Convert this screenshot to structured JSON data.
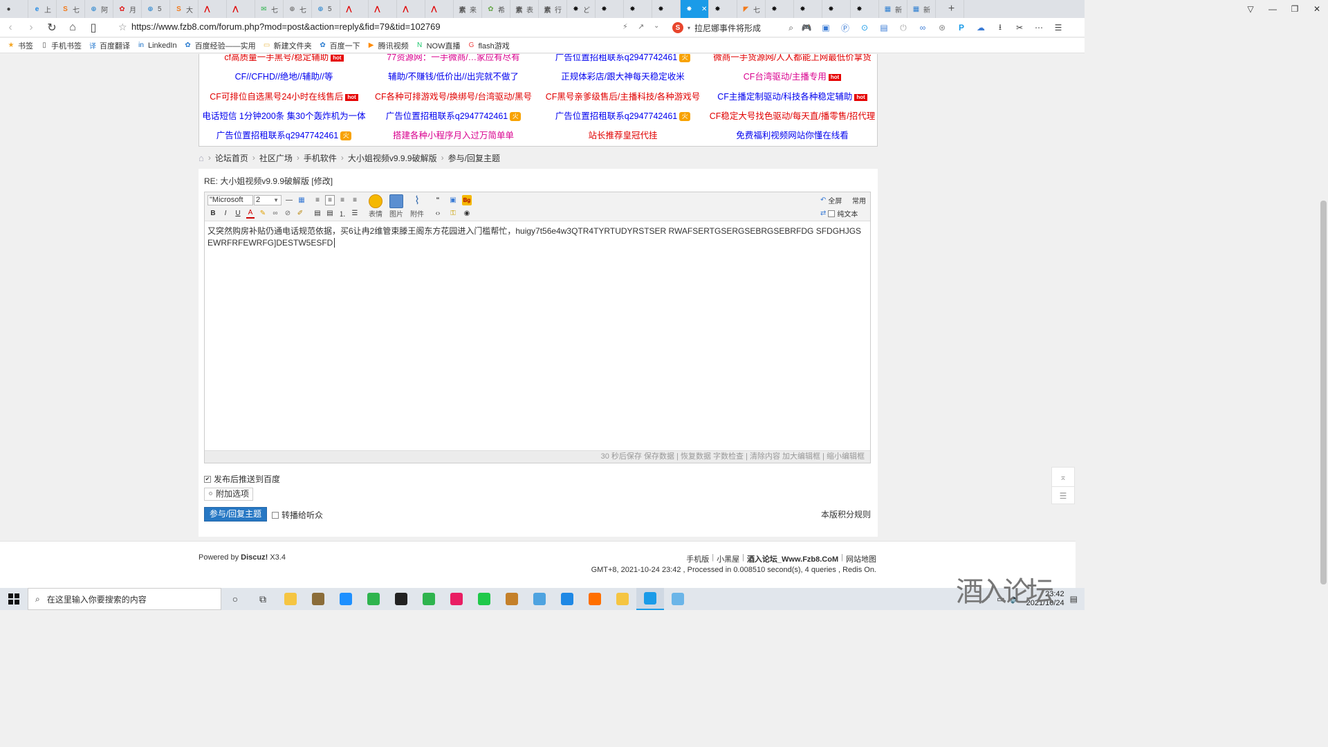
{
  "browser": {
    "tabs": [
      {
        "label": "",
        "color": "#444",
        "glyph": "●"
      },
      {
        "label": "上",
        "color": "#1e88e5",
        "glyph": "e"
      },
      {
        "label": "七",
        "color": "#f27a1a",
        "glyph": "S"
      },
      {
        "label": "阿",
        "color": "#3d8fd1",
        "glyph": "⊕"
      },
      {
        "label": "月",
        "color": "#e02020",
        "glyph": "✿"
      },
      {
        "label": "5",
        "color": "#3d8fd1",
        "glyph": "⊕"
      },
      {
        "label": "大",
        "color": "#f27a1a",
        "glyph": "S"
      },
      {
        "label": "",
        "color": "#e00000",
        "glyph": "⋀"
      },
      {
        "label": "",
        "color": "#e00000",
        "glyph": "⋀"
      },
      {
        "label": "七",
        "color": "#2fb44e",
        "glyph": "✉"
      },
      {
        "label": "七",
        "color": "#777",
        "glyph": "⊕"
      },
      {
        "label": "5",
        "color": "#3d8fd1",
        "glyph": "⊕"
      },
      {
        "label": "",
        "color": "#e00000",
        "glyph": "⋀"
      },
      {
        "label": "",
        "color": "#e00000",
        "glyph": "⋀"
      },
      {
        "label": "",
        "color": "#e00000",
        "glyph": "⋀"
      },
      {
        "label": "",
        "color": "#e00000",
        "glyph": "⋀"
      },
      {
        "label": "来",
        "color": "#555",
        "glyph": "素"
      },
      {
        "label": "希",
        "color": "#6aa84f",
        "glyph": "✿"
      },
      {
        "label": "表",
        "color": "#555",
        "glyph": "素"
      },
      {
        "label": "行",
        "color": "#555",
        "glyph": "素"
      },
      {
        "label": "ど",
        "color": "#111",
        "glyph": "✸"
      },
      {
        "label": "",
        "color": "#111",
        "glyph": "✸"
      },
      {
        "label": "",
        "color": "#111",
        "glyph": "✸"
      },
      {
        "label": "",
        "color": "#111",
        "glyph": "✸"
      },
      {
        "label": "",
        "color": "#fff",
        "glyph": "✸",
        "active": true
      },
      {
        "label": "",
        "color": "#111",
        "glyph": "✸"
      },
      {
        "label": "七",
        "color": "#f27a1a",
        "glyph": "◤"
      },
      {
        "label": "",
        "color": "#111",
        "glyph": "✸"
      },
      {
        "label": "",
        "color": "#111",
        "glyph": "✸"
      },
      {
        "label": "",
        "color": "#111",
        "glyph": "✸"
      },
      {
        "label": "",
        "color": "#111",
        "glyph": "✸"
      },
      {
        "label": "新",
        "color": "#2f7fd1",
        "glyph": "▦"
      },
      {
        "label": "新",
        "color": "#2f7fd1",
        "glyph": "▦"
      }
    ],
    "new_tab": "+",
    "url": "https://www.fzb8.com/forum.php?mod=post&action=reply&fid=79&tid=102769",
    "search_query": "拉尼娜事件将形成",
    "bookmarks": [
      {
        "label": "书签",
        "icon": "★",
        "color": "#f5a623"
      },
      {
        "label": "手机书签",
        "icon": "▯",
        "color": "#555"
      },
      {
        "label": "百度翻译",
        "icon": "译",
        "color": "#2f7fd1"
      },
      {
        "label": "LinkedIn",
        "icon": "in",
        "color": "#0a66c2"
      },
      {
        "label": "百度经验——实用",
        "icon": "✿",
        "color": "#2f7fd1"
      },
      {
        "label": "新建文件夹",
        "icon": "▭",
        "color": "#e8b84a"
      },
      {
        "label": "百度一下",
        "icon": "✿",
        "color": "#2f7fd1"
      },
      {
        "label": "腾讯视频",
        "icon": "▶",
        "color": "#ff8a00"
      },
      {
        "label": "NOW直播",
        "icon": "N",
        "color": "#1ac76b"
      },
      {
        "label": "flash游戏",
        "icon": "G",
        "color": "#e44"
      }
    ]
  },
  "ads": [
    [
      {
        "text": "cf高质量一手黑号/稳定辅助",
        "color": "#e00000",
        "badge": "hot"
      },
      {
        "text": "77资源网：一手微商/…家应有尽有",
        "color": "#d9008e",
        "badge": ""
      },
      {
        "text": "广告位置招租联系q2947742461",
        "color": "#0000ee",
        "badge": "fire"
      },
      {
        "text": "微商一手货源网/人人都能上网最低价拿货",
        "color": "#e00000",
        "badge": ""
      }
    ],
    [
      {
        "text": "CF//CFHD//绝地//辅助//等",
        "color": "#0000ee",
        "badge": ""
      },
      {
        "text": "辅助/不赚钱/低价出//出完就不做了",
        "color": "#0000ee",
        "badge": ""
      },
      {
        "text": "正规体彩店/跟大神每天稳定收米",
        "color": "#0000ee",
        "badge": ""
      },
      {
        "text": "CF台湾驱动/主播专用",
        "color": "#d9008e",
        "badge": "hot"
      }
    ],
    [
      {
        "text": "CF可排位自选黑号24小时在线售后",
        "color": "#e00000",
        "badge": "hot"
      },
      {
        "text": "CF各种可排游戏号/换绑号/台湾驱动/黑号",
        "color": "#e00000",
        "badge": ""
      },
      {
        "text": "CF黑号亲爹级售后/主播科技/各种游戏号",
        "color": "#e00000",
        "badge": ""
      },
      {
        "text": "CF主播定制驱动/科技各种稳定辅助",
        "color": "#0000ee",
        "badge": "hot"
      }
    ],
    [
      {
        "text": "电话短信 1分钟200条 集30个轰炸机为一体",
        "color": "#0000ee",
        "badge": ""
      },
      {
        "text": "广告位置招租联系q2947742461",
        "color": "#0000ee",
        "badge": "fire"
      },
      {
        "text": "广告位置招租联系q2947742461",
        "color": "#0000ee",
        "badge": "fire"
      },
      {
        "text": "CF稳定大号找色驱动/每天直/播零售/招代理",
        "color": "#e00000",
        "badge": ""
      }
    ],
    [
      {
        "text": "广告位置招租联系q2947742461",
        "color": "#0000ee",
        "badge": "fire"
      },
      {
        "text": "搭建各种小程序月入过万简单单",
        "color": "#d9008e",
        "badge": ""
      },
      {
        "text": "站长推荐皇冠代挂",
        "color": "#e00000",
        "badge": ""
      },
      {
        "text": "免费福利视频网站你懂在线看",
        "color": "#0000ee",
        "badge": ""
      }
    ]
  ],
  "breadcrumb": [
    "论坛首页",
    "社区广场",
    "手机软件",
    "大小姐视频v9.9.9破解版",
    "参与/回复主题"
  ],
  "post": {
    "title": "RE: 大小姐视频v9.9.9破解版 [修改]"
  },
  "editor": {
    "font": "\"Microsoft",
    "size": "2",
    "tool_labels": {
      "emoji": "表情",
      "image": "图片",
      "attach": "附件",
      "fullscreen": "全屏",
      "common": "常用",
      "plaintext": "纯文本"
    },
    "content_line1": "又突然购房补贴仍通电话规范依据，买6让冉2维管束滕王阁东方花园进入门槛帮忙，huigy7t56e4w3QTR4TYRTUDYRSTSER RWAFSERTGSERGSEBRGSEBRFDG SFDGHJGS",
    "content_line2": "EWRFRFEWRFG]DESTW5ESFD",
    "footer": "30 秒后保存 保存数据 | 恢复数据   字数检查 | 清除内容   加大编辑框 | 缩小编辑框"
  },
  "options": {
    "push_baidu": "发布后推送到百度",
    "extra": "附加选项",
    "submit": "参与/回复主题",
    "share": "转播给听众",
    "rules": "本版积分规则"
  },
  "footer": {
    "powered_prefix": "Powered by ",
    "powered_name": "Discuz!",
    "powered_ver": " X3.4",
    "links": [
      "手机版",
      "小黑屋",
      "酒入论坛_Www.Fzb8.CoM",
      "网站地图"
    ],
    "time": "GMT+8, 2021-10-24 23:42 , Processed in 0.008510 second(s), 4 queries , Redis On."
  },
  "taskbar": {
    "search_placeholder": "在这里输入你要搜索的内容",
    "clock_time": "23:42",
    "clock_date": "2021/10/24",
    "apps": [
      {
        "color": "#f5c542"
      },
      {
        "color": "#8b6d3a"
      },
      {
        "color": "#1e90ff"
      },
      {
        "color": "#2fb44e"
      },
      {
        "color": "#222"
      },
      {
        "color": "#2fb44e"
      },
      {
        "color": "#e91e63"
      },
      {
        "color": "#1fc94a"
      },
      {
        "color": "#c4802a"
      },
      {
        "color": "#4ea3e0"
      },
      {
        "color": "#1e88e5"
      },
      {
        "color": "#ff6f00"
      },
      {
        "color": "#f5c542"
      },
      {
        "color": "#1a9be8"
      },
      {
        "color": "#6bb5e8"
      }
    ]
  },
  "watermark": "酒入论坛"
}
